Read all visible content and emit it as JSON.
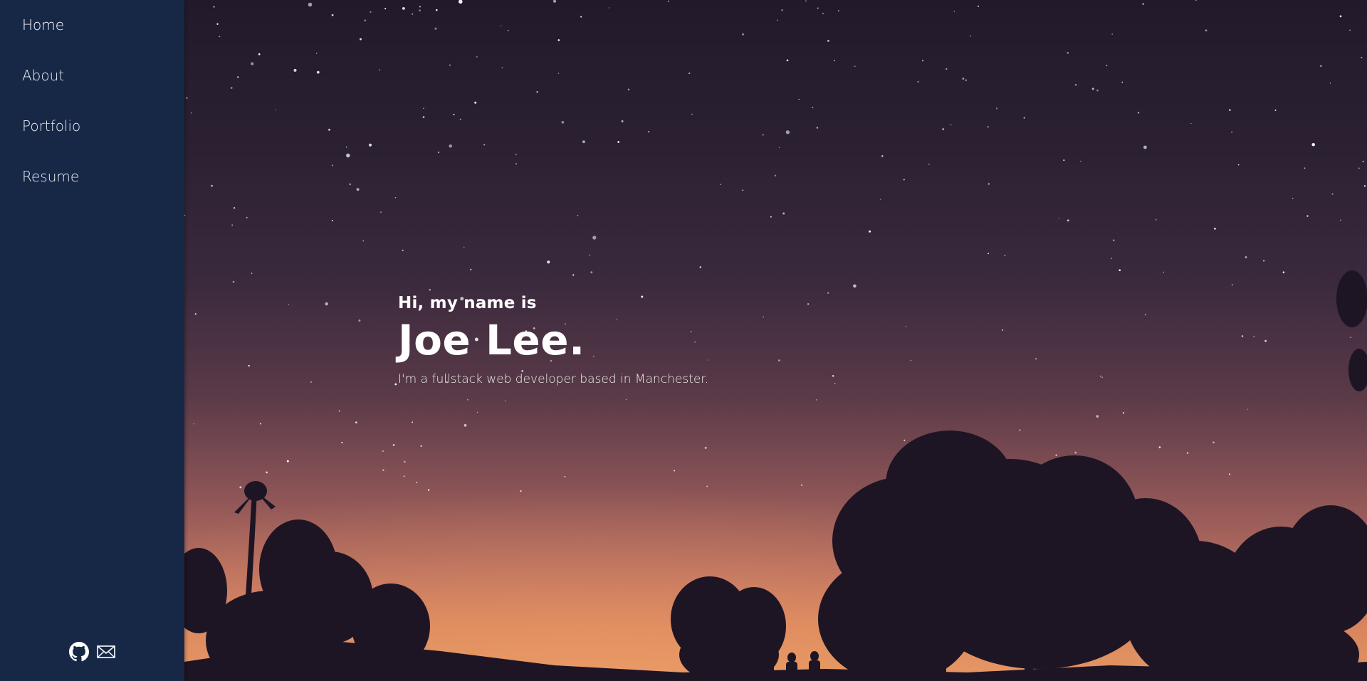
{
  "nav": {
    "items": [
      {
        "label": "Home"
      },
      {
        "label": "About"
      },
      {
        "label": "Portfolio"
      },
      {
        "label": "Resume"
      }
    ]
  },
  "social": {
    "github_icon": "github-icon",
    "email_icon": "envelope-icon"
  },
  "hero": {
    "greeting": "Hi, my name is",
    "name": "Joe Lee.",
    "tagline": "I'm a fullstack web developer based in Manchester."
  },
  "colors": {
    "sidebar_bg": "#172847",
    "text": "#ffffff",
    "sky_top": "#221a2b",
    "horizon": "#e29562"
  }
}
